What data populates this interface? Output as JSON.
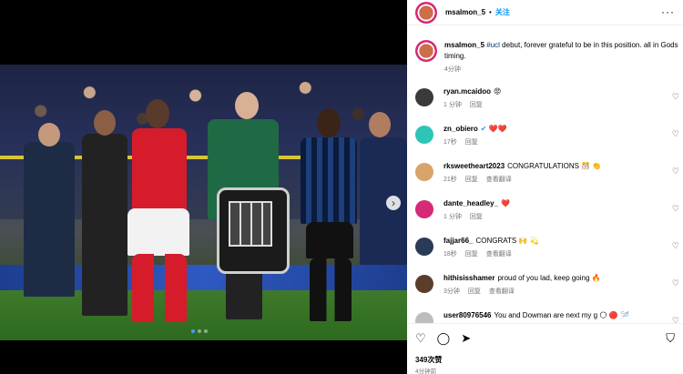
{
  "post": {
    "username": "msalmon_5",
    "separator": "•",
    "follow_label": "关注",
    "more_icon": "more-horizontal-icon"
  },
  "caption": {
    "username": "msalmon_5",
    "hashtag": "#ucl",
    "text": " debut, forever grateful to be in this position. all in Gods timing.",
    "time": "4分钟"
  },
  "comments": [
    {
      "user": "ryan.mcaidoo",
      "text": "😡",
      "time": "1 分钟",
      "reply": "回复",
      "translate": "",
      "avatar_color": "#3a3a3a",
      "verified": false
    },
    {
      "user": "zn_obiero",
      "text": "❤️❤️",
      "time": "17秒",
      "reply": "回复",
      "translate": "",
      "avatar_color": "#2ec4b6",
      "verified": true
    },
    {
      "user": "rksweetheart2023",
      "text": "CONGRATULATIONS 🎊 👏",
      "time": "21秒",
      "reply": "回复",
      "translate": "查看翻译",
      "avatar_color": "#d9a36b",
      "verified": false
    },
    {
      "user": "dante_headley_",
      "text": "❤️",
      "time": "1 分钟",
      "reply": "回复",
      "translate": "",
      "avatar_color": "#d62976",
      "verified": false
    },
    {
      "user": "fajjar66_",
      "text": "CONGRATS 🙌 💫",
      "time": "18秒",
      "reply": "回复",
      "translate": "查看翻译",
      "avatar_color": "#2b3a55",
      "verified": false
    },
    {
      "user": "hithisisshamer",
      "text": "proud of you lad, keep going 🔥",
      "time": "3分钟",
      "reply": "回复",
      "translate": "查看翻译",
      "avatar_color": "#5a3e2b",
      "verified": false
    },
    {
      "user": "user80976546",
      "text": "You and Dowman are next my g 🌕 🔴 🪡",
      "time": "",
      "reply": "",
      "translate": "",
      "avatar_color": "#bdbdbd",
      "verified": false
    }
  ],
  "actions": {
    "like_icon": "heart-icon",
    "comment_icon": "comment-icon",
    "share_icon": "share-icon",
    "save_icon": "bookmark-icon",
    "views": "349次赞",
    "time": "4分钟前"
  },
  "media": {
    "carousel_dots": 3,
    "active_dot": 1,
    "next_icon": "chevron-right-icon"
  }
}
